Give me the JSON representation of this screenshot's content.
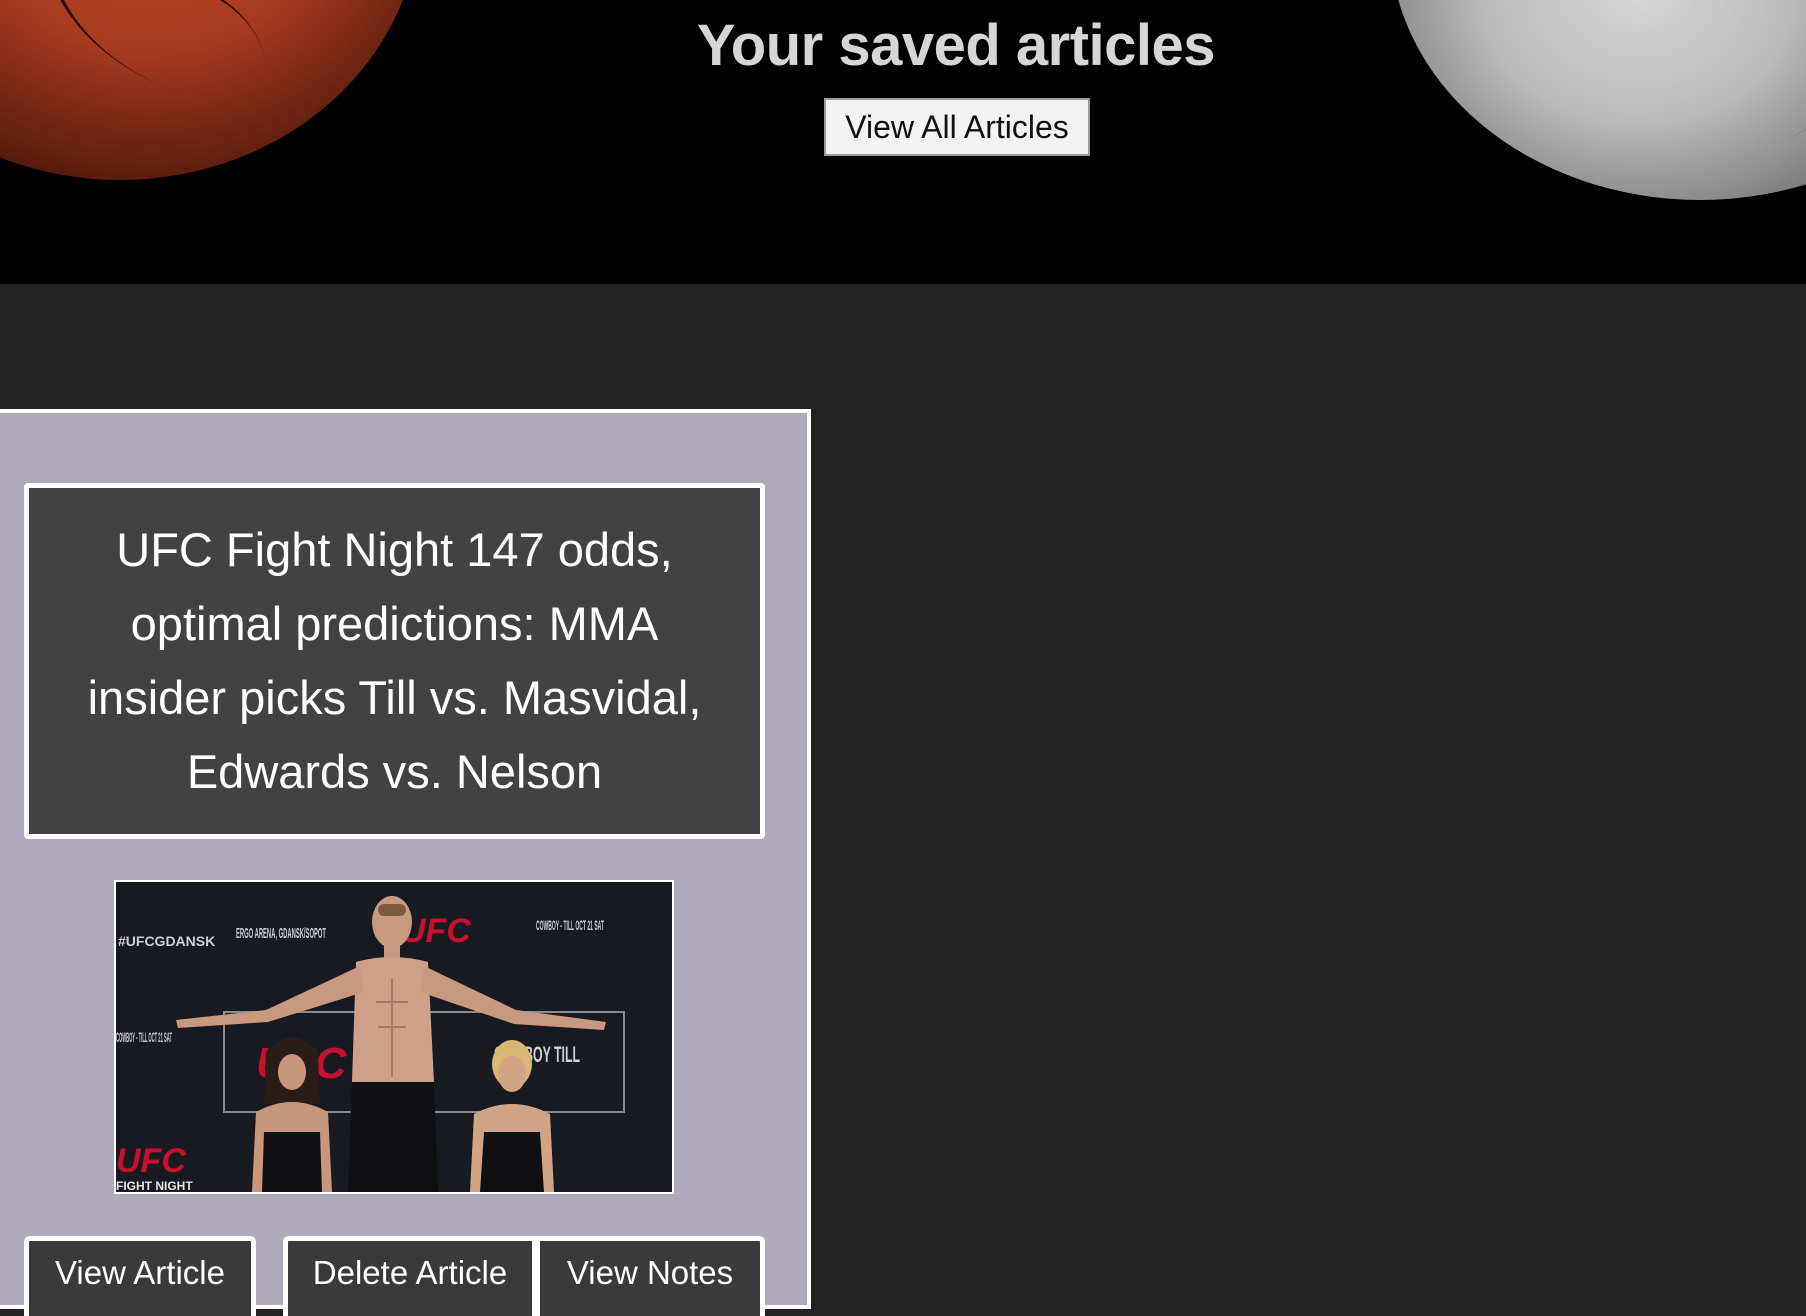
{
  "header": {
    "title": "Your saved articles",
    "view_all_label": "View All Articles"
  },
  "article": {
    "title": "UFC Fight Night 147 odds, optimal predictions: MMA insider picks Till vs. Masvidal, Edwards vs. Nelson",
    "image_text": {
      "arena": "ERGO ARENA, GDANSK/SOPOT",
      "event_top": "COWBOY - TILL OCT 21 SAT",
      "event_left": "COWBOY - TILL OCT 21 SAT",
      "event_banner": "COWBOY TILL",
      "hashtag": "#UFCGDANSK",
      "ufc_logo": "UFC",
      "fight_night": "FIGHT NIGHT"
    },
    "buttons": {
      "view_article": "View Article",
      "delete_article": "Delete Article",
      "view_notes": "View Notes"
    }
  },
  "colors": {
    "page_bg": "#232323",
    "hero_bg": "#000000",
    "card_bg": "#aeaabb",
    "title_box_bg": "#424242",
    "button_bg": "#3a3a3a",
    "ufc_red": "#c8102e"
  }
}
